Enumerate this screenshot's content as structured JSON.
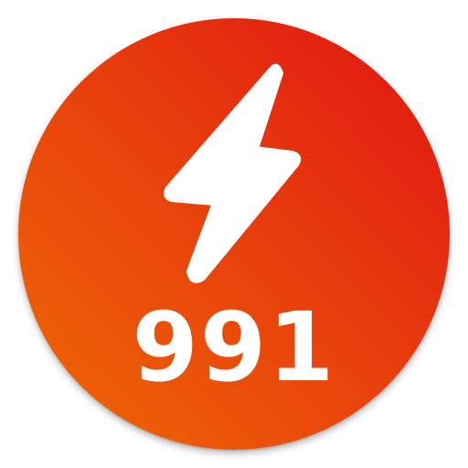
{
  "icon": {
    "glyph": "lightning-bolt",
    "number": "991",
    "colors": {
      "gradient_start": "#e01313",
      "gradient_mid": "#e8400c",
      "gradient_end": "#ee6a05",
      "foreground": "#ffffff"
    }
  }
}
